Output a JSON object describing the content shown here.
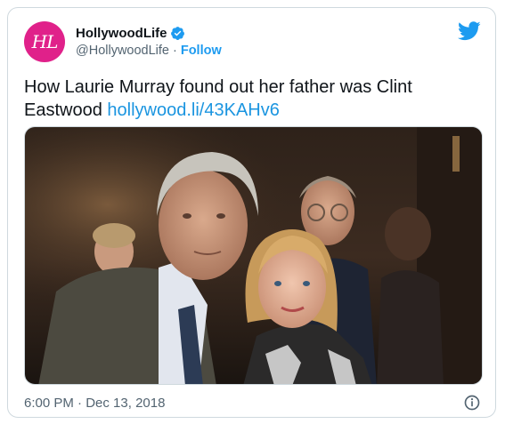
{
  "account": {
    "display_name": "HollywoodLife",
    "handle": "@HollywoodLife",
    "separator": "·",
    "follow_label": "Follow",
    "avatar_text": "HL",
    "verified": true
  },
  "tweet": {
    "text": "How Laurie Murray found out her father was Clint Eastwood",
    "link": "hollywood.li/43KAHv6"
  },
  "footer": {
    "time": "6:00 PM",
    "separator": "·",
    "date": "Dec 13, 2018"
  },
  "icons": {
    "brand": "twitter-bird-icon",
    "verified": "verified-badge-icon",
    "info": "info-icon"
  },
  "colors": {
    "accent": "#1d9bf0",
    "avatar_bg": "#e0218a",
    "muted_text": "#536471",
    "border": "#cfd9de"
  }
}
